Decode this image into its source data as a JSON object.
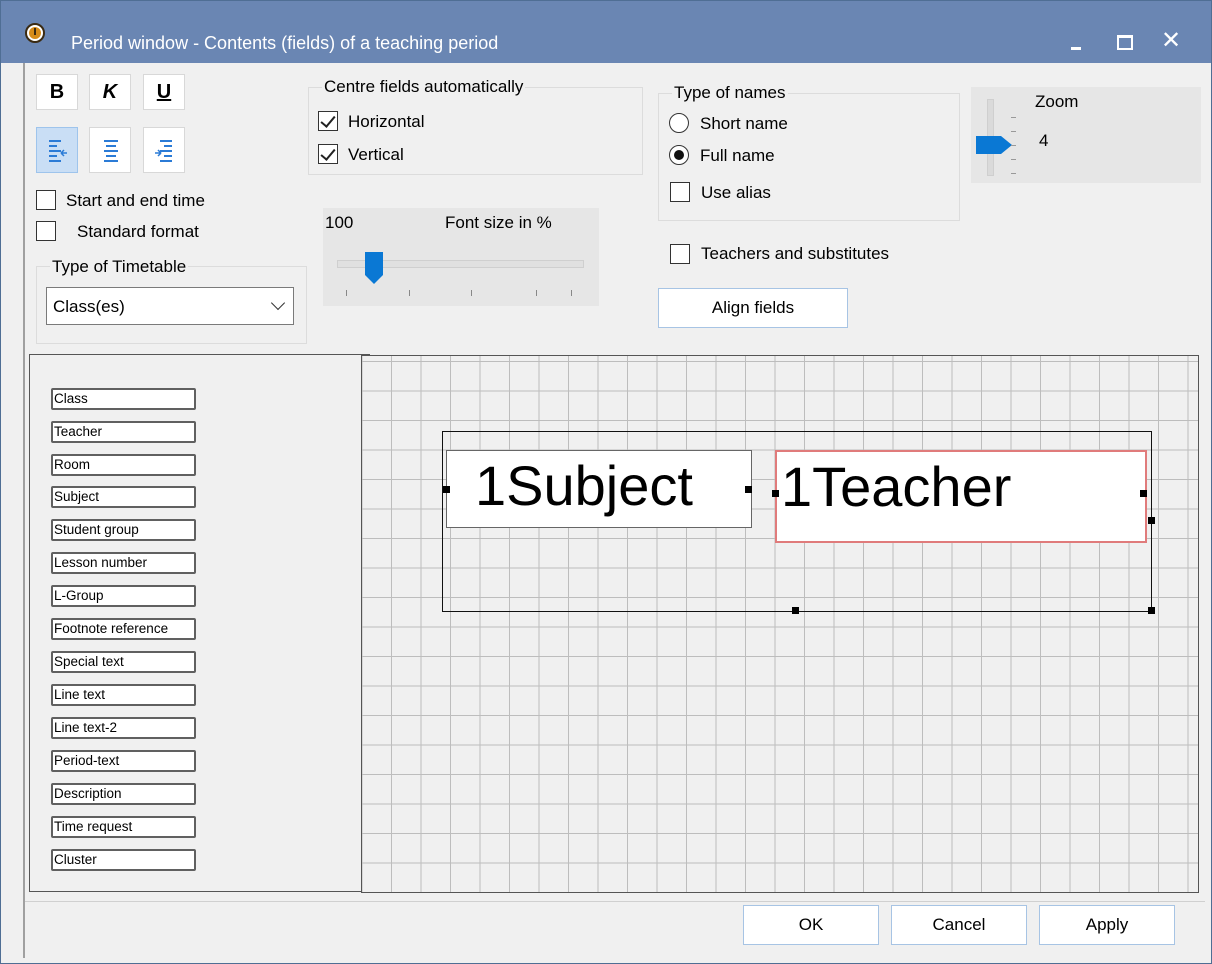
{
  "window": {
    "title": "Period window - Contents (fields) of a teaching period",
    "icons": {
      "app": "clock-icon",
      "minimize": "minimize-icon",
      "maximize": "maximize-icon",
      "close": "close-icon"
    },
    "close_glyph": "✕"
  },
  "format": {
    "bold_label": "B",
    "italic_label": "K",
    "underline_label": "U",
    "align_icons": [
      "align-left-icon",
      "align-center-icon",
      "align-right-icon"
    ],
    "align_active_index": 0
  },
  "options": {
    "start_end_time": {
      "label": "Start and end time",
      "checked": false
    },
    "standard_format": {
      "label": "Standard format",
      "checked": false
    }
  },
  "timetable_type": {
    "legend": "Type of Timetable",
    "selected": "Class(es)"
  },
  "centre": {
    "legend": "Centre fields automatically",
    "horizontal": {
      "label": "Horizontal",
      "checked": true
    },
    "vertical": {
      "label": "Vertical",
      "checked": true
    }
  },
  "font_size": {
    "value": "100",
    "label": "Font size in %",
    "level": 0.15
  },
  "names": {
    "legend": "Type of names",
    "short": {
      "label": "Short name",
      "selected": false
    },
    "full": {
      "label": "Full name",
      "selected": true
    },
    "alias": {
      "label": "Use alias",
      "checked": false
    }
  },
  "teachers_substitutes": {
    "label": "Teachers and substitutes",
    "checked": false
  },
  "align_fields_label": "Align fields",
  "zoom": {
    "label": "Zoom",
    "value": "4"
  },
  "field_list": [
    "Class",
    "Teacher",
    "Room",
    "Subject",
    "Student group",
    "Lesson number",
    "L-Group",
    "Footnote reference",
    "Special text",
    "Line text",
    "Line text-2",
    "Period-text",
    "Description",
    "Time request",
    "Cluster"
  ],
  "preview": {
    "subject_field": "1Subject",
    "teacher_field": "1Teacher"
  },
  "buttons": {
    "ok": "OK",
    "cancel": "Cancel",
    "apply": "Apply"
  },
  "colors": {
    "titlebar": "#6a86b3",
    "accent": "#0a78d4",
    "selection_border": "#e07b7b"
  }
}
